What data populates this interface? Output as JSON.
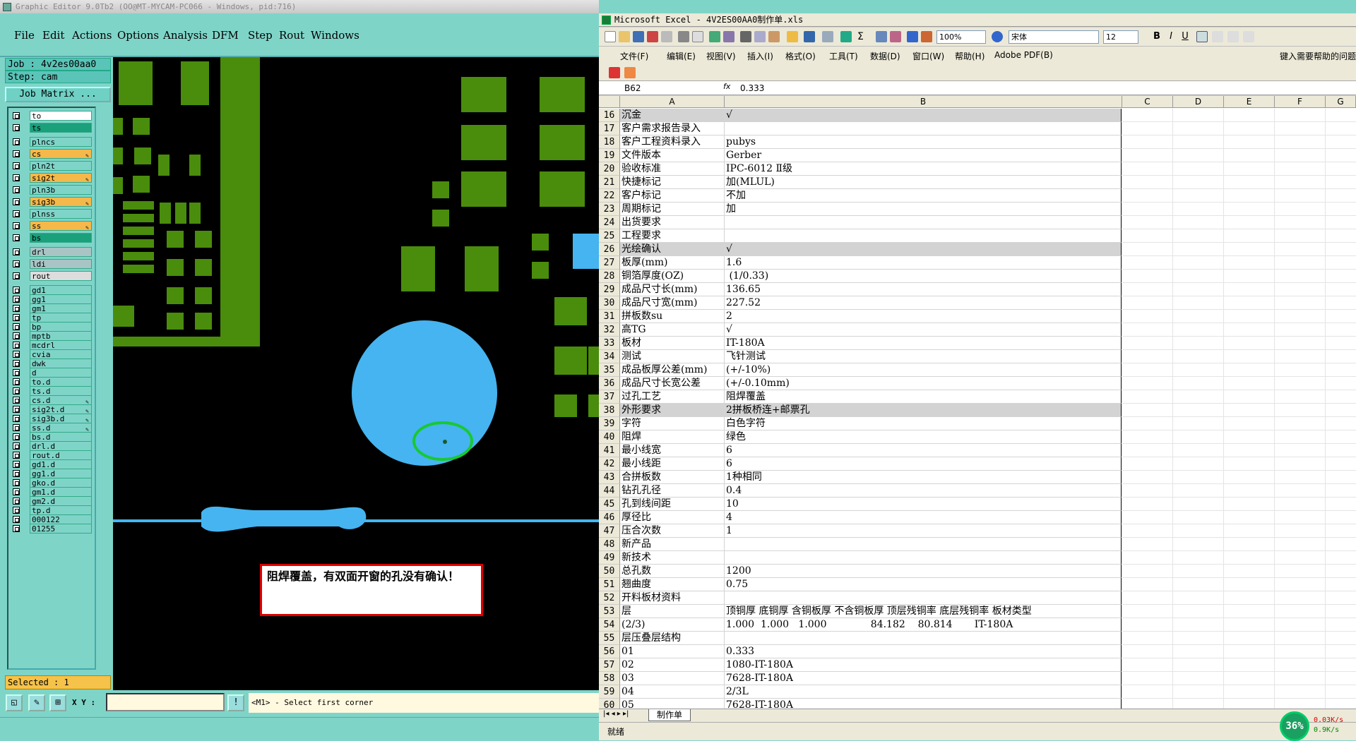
{
  "editor": {
    "title": "Graphic Editor 9.0Tb2 (OO@MT-MYCAM-PC066 - Windows, pid:716)",
    "menu": [
      "File",
      "Edit",
      "Actions",
      "Options",
      "Analysis",
      "DFM",
      "Step",
      "Rout",
      "Windows"
    ],
    "job": "Job : 4v2es00aa0",
    "step": "Step: cam",
    "job_matrix_label": "Job Matrix ...",
    "layers": [
      {
        "name": "to",
        "color": "#ffffff"
      },
      {
        "name": "ts",
        "color": "#1aa07a"
      },
      {
        "name": "plncs",
        "color": "#7fd4c8"
      },
      {
        "name": "cs",
        "color": "#f5b84a",
        "pen": true
      },
      {
        "name": "pln2t",
        "color": "#7fd4c8"
      },
      {
        "name": "sig2t",
        "color": "#f5b84a",
        "pen": true
      },
      {
        "name": "pln3b",
        "color": "#7fd4c8"
      },
      {
        "name": "sig3b",
        "color": "#f5b84a",
        "pen": true
      },
      {
        "name": "plnss",
        "color": "#7fd4c8"
      },
      {
        "name": "ss",
        "color": "#f5b84a",
        "pen": true
      },
      {
        "name": "bs",
        "color": "#1aa07a"
      },
      {
        "name": "drl",
        "color": "#a9c4c4"
      },
      {
        "name": "ldi",
        "color": "#a9c4c4"
      },
      {
        "name": "rout",
        "color": "#dddddd"
      },
      {
        "name": "gd1",
        "color": "#7fd4c8"
      },
      {
        "name": "gg1",
        "color": "#7fd4c8"
      },
      {
        "name": "gm1",
        "color": "#7fd4c8"
      },
      {
        "name": "tp",
        "color": "#7fd4c8"
      },
      {
        "name": "bp",
        "color": "#7fd4c8"
      },
      {
        "name": "mptb",
        "color": "#7fd4c8"
      },
      {
        "name": "mcdrl",
        "color": "#7fd4c8"
      },
      {
        "name": "cvia",
        "color": "#7fd4c8"
      },
      {
        "name": "dwk",
        "color": "#7fd4c8"
      },
      {
        "name": "d",
        "color": "#7fd4c8"
      },
      {
        "name": "to.d",
        "color": "#7fd4c8"
      },
      {
        "name": "ts.d",
        "color": "#7fd4c8"
      },
      {
        "name": "cs.d",
        "color": "#7fd4c8",
        "pen": true
      },
      {
        "name": "sig2t.d",
        "color": "#7fd4c8",
        "pen": true
      },
      {
        "name": "sig3b.d",
        "color": "#7fd4c8",
        "pen": true
      },
      {
        "name": "ss.d",
        "color": "#7fd4c8",
        "pen": true
      },
      {
        "name": "bs.d",
        "color": "#7fd4c8"
      },
      {
        "name": "drl.d",
        "color": "#7fd4c8"
      },
      {
        "name": "rout.d",
        "color": "#7fd4c8"
      },
      {
        "name": "gd1.d",
        "color": "#7fd4c8"
      },
      {
        "name": "gg1.d",
        "color": "#7fd4c8"
      },
      {
        "name": "gko.d",
        "color": "#7fd4c8"
      },
      {
        "name": "gm1.d",
        "color": "#7fd4c8"
      },
      {
        "name": "gm2.d",
        "color": "#7fd4c8"
      },
      {
        "name": "tp.d",
        "color": "#7fd4c8"
      },
      {
        "name": "000122",
        "color": "#7fd4c8"
      },
      {
        "name": "01255",
        "color": "#7fd4c8"
      }
    ],
    "selected": "Selected : 1",
    "xy_label": "X Y :",
    "xy_value": "",
    "prompt": "<M1> - Select first corner",
    "popup": "阻焊覆盖，有双面开窗的孔没有确认！",
    "colors": {
      "pad": "#4a8c0c",
      "mask": "#45b4f0",
      "highlight": "#19c832",
      "bg": "#000000"
    }
  },
  "excel": {
    "title": "Microsoft Excel - 4V2ES00AA0制作单.xls",
    "zoom": "100%",
    "font": "宋体",
    "font_size": "12",
    "menu": [
      "文件(F)",
      "编辑(E)",
      "视图(V)",
      "插入(I)",
      "格式(O)",
      "工具(T)",
      "数据(D)",
      "窗口(W)",
      "帮助(H)",
      "Adobe PDF(B)"
    ],
    "help_box": "键入需要帮助的问题",
    "name_box": "B62",
    "fx": "fx",
    "formula": "0.333",
    "columns": [
      "A",
      "B",
      "C",
      "D",
      "E",
      "F",
      "G"
    ],
    "rows": [
      {
        "n": "16",
        "a": "沉金",
        "b": "√",
        "hl": true
      },
      {
        "n": "17",
        "a": "客户需求报告录入",
        "b": ""
      },
      {
        "n": "18",
        "a": "客户工程资料录入",
        "b": "pubys"
      },
      {
        "n": "19",
        "a": "文件版本",
        "b": "Gerber"
      },
      {
        "n": "20",
        "a": "验收标准",
        "b": "IPC-6012 Ⅱ级"
      },
      {
        "n": "21",
        "a": "快捷标记",
        "b": "加(MLUL)"
      },
      {
        "n": "22",
        "a": "客户标记",
        "b": "不加"
      },
      {
        "n": "23",
        "a": "周期标记",
        "b": "加"
      },
      {
        "n": "24",
        "a": "出货要求",
        "b": ""
      },
      {
        "n": "25",
        "a": "工程要求",
        "b": ""
      },
      {
        "n": "26",
        "a": "光绘确认",
        "b": "√",
        "hl": true
      },
      {
        "n": "27",
        "a": "板厚(mm)",
        "b": "1.6"
      },
      {
        "n": "28",
        "a": "铜箔厚度(OZ)",
        "b": " (1/0.33)"
      },
      {
        "n": "29",
        "a": "成品尺寸长(mm)",
        "b": "136.65"
      },
      {
        "n": "30",
        "a": "成品尺寸宽(mm)",
        "b": "227.52"
      },
      {
        "n": "31",
        "a": "拼板数su",
        "b": "2"
      },
      {
        "n": "32",
        "a": "高TG",
        "b": "√"
      },
      {
        "n": "33",
        "a": "板材",
        "b": "IT-180A"
      },
      {
        "n": "34",
        "a": "测试",
        "b": "飞针测试"
      },
      {
        "n": "35",
        "a": "成品板厚公差(mm)",
        "b": "(+/-10%)"
      },
      {
        "n": "36",
        "a": "成品尺寸长宽公差",
        "b": "(+/-0.10mm)"
      },
      {
        "n": "37",
        "a": "过孔工艺",
        "b": "阻焊覆盖"
      },
      {
        "n": "38",
        "a": "外形要求",
        "b": "2拼板桥连+邮票孔",
        "hl": true
      },
      {
        "n": "39",
        "a": "字符",
        "b": "白色字符"
      },
      {
        "n": "40",
        "a": "阻焊",
        "b": "绿色"
      },
      {
        "n": "41",
        "a": "最小线宽",
        "b": "6"
      },
      {
        "n": "42",
        "a": "最小线距",
        "b": "6"
      },
      {
        "n": "43",
        "a": "合拼板数",
        "b": "1种相同"
      },
      {
        "n": "44",
        "a": "钻孔孔径",
        "b": "0.4"
      },
      {
        "n": "45",
        "a": "孔到线间距",
        "b": "10"
      },
      {
        "n": "46",
        "a": "厚径比",
        "b": "4"
      },
      {
        "n": "47",
        "a": "压合次数",
        "b": "1"
      },
      {
        "n": "48",
        "a": "新产品",
        "b": ""
      },
      {
        "n": "49",
        "a": "新技术",
        "b": ""
      },
      {
        "n": "50",
        "a": "总孔数",
        "b": "1200"
      },
      {
        "n": "51",
        "a": "翘曲度",
        "b": "0.75"
      },
      {
        "n": "52",
        "a": "开料板材资料",
        "b": ""
      },
      {
        "n": "53",
        "a": "层",
        "b": "顶铜厚 底铜厚 含铜板厚 不含铜板厚 顶层残铜率 底层残铜率 板材类型"
      },
      {
        "n": "54",
        "a": "(2/3)",
        "b": "1.000  1.000   1.000              84.182    80.814       IT-180A"
      },
      {
        "n": "55",
        "a": "层压叠层结构",
        "b": ""
      },
      {
        "n": "56",
        "a": "01",
        "b": "0.333"
      },
      {
        "n": "57",
        "a": "02",
        "b": "1080-IT-180A"
      },
      {
        "n": "58",
        "a": "03",
        "b": "7628-IT-180A"
      },
      {
        "n": "59",
        "a": "04",
        "b": "2/3L"
      },
      {
        "n": "60",
        "a": "05",
        "b": "7628-IT-180A"
      }
    ],
    "sheet_tab": "制作单",
    "status": "就绪",
    "net_percent": "36%",
    "net_up": "0.03K/s",
    "net_down": "0.9K/s"
  }
}
